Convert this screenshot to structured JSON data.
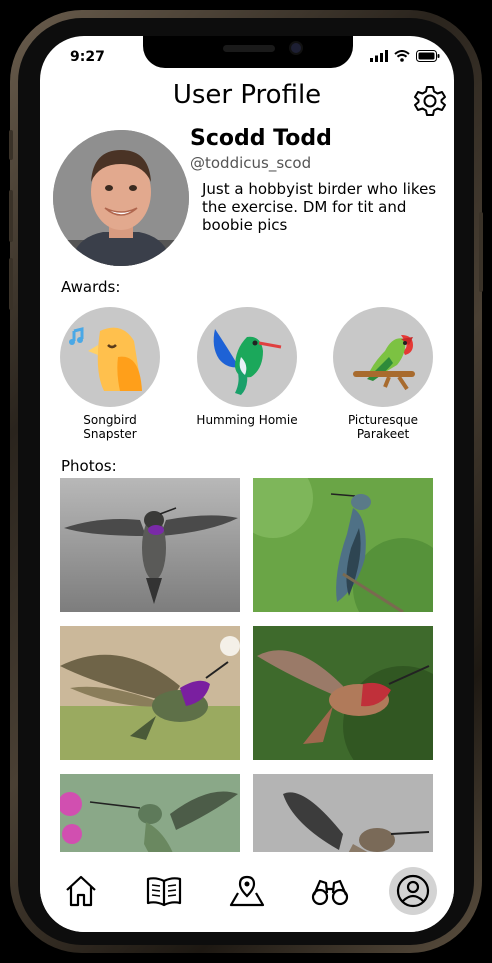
{
  "status_bar": {
    "time": "9:27"
  },
  "header": {
    "title": "User Profile"
  },
  "profile": {
    "name": "Scodd Todd",
    "handle": "@toddicus_scod",
    "bio": "Just a hobbyist birder who likes the exercise. DM for tit and boobie pics"
  },
  "awards": {
    "label": "Awards:",
    "items": [
      {
        "label": "Songbird Snapster",
        "icon": "songbird-icon"
      },
      {
        "label": "Humming Homie",
        "icon": "hummingbird-icon"
      },
      {
        "label": "Picturesque Parakeet",
        "icon": "parakeet-icon"
      }
    ]
  },
  "photos": {
    "label": "Photos:",
    "items": [
      "hummingbird-photo",
      "hummingbird-photo",
      "hummingbird-photo",
      "hummingbird-photo",
      "hummingbird-photo",
      "hummingbird-photo"
    ]
  },
  "nav": {
    "items": [
      "home-icon",
      "book-icon",
      "map-icon",
      "binoculars-icon",
      "profile-icon"
    ],
    "active": "profile-icon"
  }
}
